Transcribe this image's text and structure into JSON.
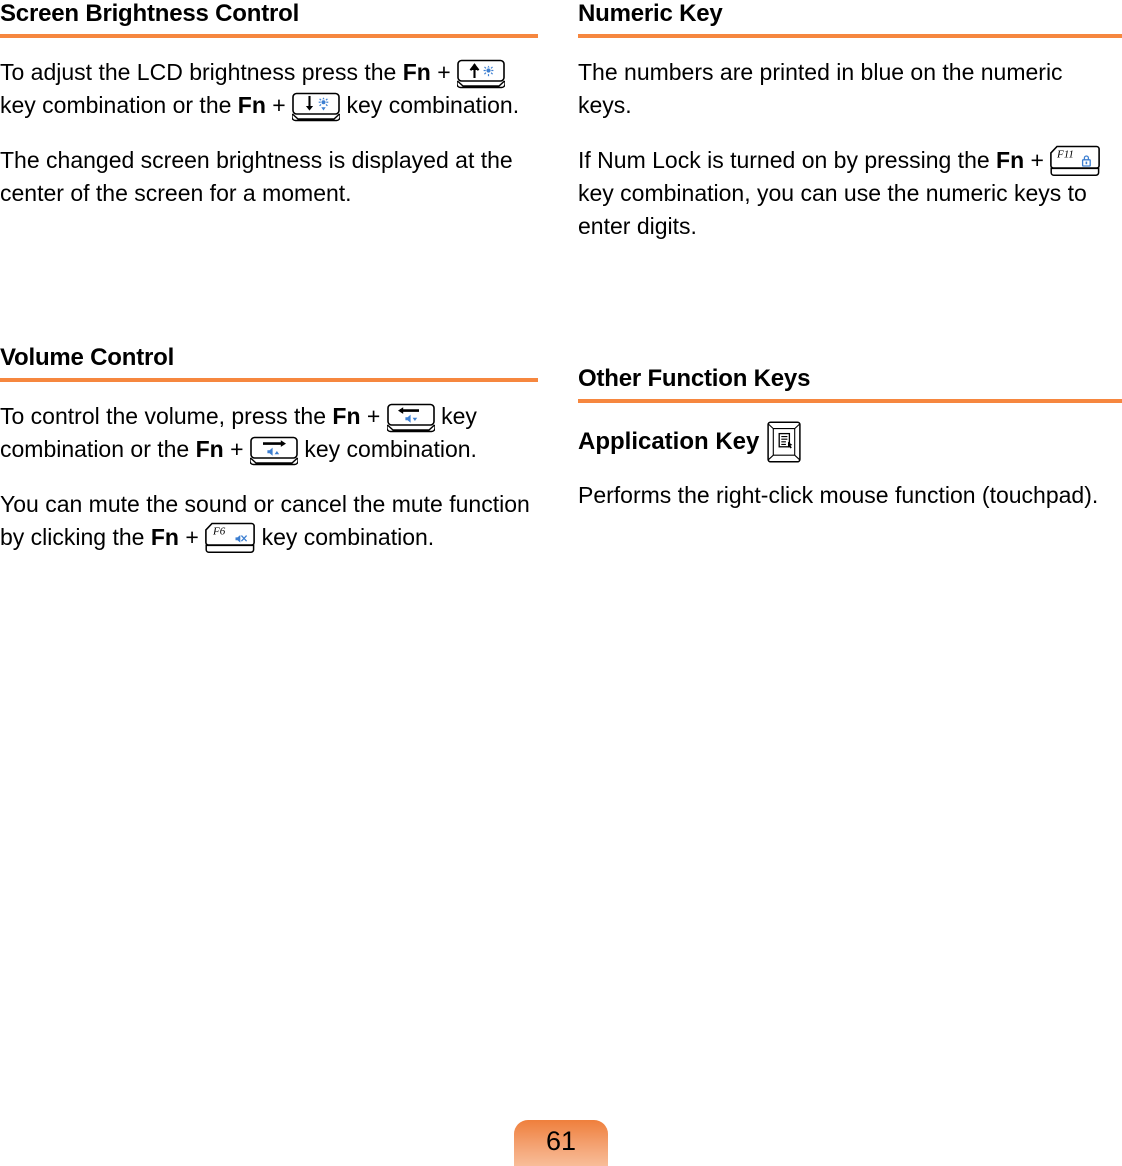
{
  "page": {
    "number": "61",
    "accent_color": "#f6873f",
    "key_icon_blue": "#3d7fd1",
    "text_color": "#000000",
    "background": "#ffffff"
  },
  "left_column": {
    "sections": [
      {
        "heading": "Screen Brightness Control",
        "paragraphs": [
          {
            "parts": [
              {
                "type": "text",
                "value": "To adjust the LCD brightness press the "
              },
              {
                "type": "bold",
                "value": "Fn"
              },
              {
                "type": "text",
                "value": " + "
              },
              {
                "type": "key",
                "value": "brightness-up-key"
              },
              {
                "type": "text",
                "value": " key combination or the "
              },
              {
                "type": "bold",
                "value": "Fn"
              },
              {
                "type": "text",
                "value": " + "
              },
              {
                "type": "key",
                "value": "brightness-down-key"
              },
              {
                "type": "text",
                "value": " key combination."
              }
            ]
          },
          {
            "parts": [
              {
                "type": "text",
                "value": "The changed screen brightness is displayed at the center of the screen for a moment."
              }
            ]
          }
        ]
      },
      {
        "heading": "Volume Control",
        "paragraphs": [
          {
            "parts": [
              {
                "type": "text",
                "value": "To control the volume, press the "
              },
              {
                "type": "bold",
                "value": "Fn"
              },
              {
                "type": "text",
                "value": " + "
              },
              {
                "type": "key",
                "value": "volume-down-key"
              },
              {
                "type": "text",
                "value": " key combination or the "
              },
              {
                "type": "bold",
                "value": "Fn"
              },
              {
                "type": "text",
                "value": " + "
              },
              {
                "type": "key",
                "value": "volume-up-key"
              },
              {
                "type": "text",
                "value": " key combination."
              }
            ]
          },
          {
            "parts": [
              {
                "type": "text",
                "value": "You can mute the sound or cancel the mute function by clicking the "
              },
              {
                "type": "bold",
                "value": "Fn"
              },
              {
                "type": "text",
                "value": " + "
              },
              {
                "type": "key",
                "value": "mute-key-f6"
              },
              {
                "type": "text",
                "value": " key combination."
              }
            ]
          }
        ]
      }
    ]
  },
  "right_column": {
    "sections": [
      {
        "heading": "Numeric Key",
        "paragraphs": [
          {
            "parts": [
              {
                "type": "text",
                "value": "The numbers are printed in blue on the numeric keys."
              }
            ]
          },
          {
            "parts": [
              {
                "type": "text",
                "value": "If Num Lock is turned on by pressing the "
              },
              {
                "type": "bold",
                "value": "Fn"
              },
              {
                "type": "text",
                "value": " + "
              },
              {
                "type": "key",
                "value": "num-lock-key-f11"
              },
              {
                "type": "text",
                "value": " key combination, you can use the numeric keys to enter digits."
              }
            ]
          }
        ]
      },
      {
        "heading": "Other Function Keys",
        "subheading": "Application Key",
        "subheading_key": "application-key",
        "paragraphs": [
          {
            "parts": [
              {
                "type": "text",
                "value": "Performs the right-click mouse function (touchpad)."
              }
            ]
          }
        ]
      }
    ]
  },
  "text": {
    "brightness_p1_a": "To adjust the LCD brightness press the ",
    "brightness_p1_fn1": "Fn",
    "brightness_p1_plus1": " + ",
    "brightness_p1_b": " key combination or the ",
    "brightness_p1_fn2": "Fn",
    "brightness_p1_plus2": " + ",
    "brightness_p1_c": " key combination.",
    "brightness_p2": "The changed screen brightness is displayed at the center of the screen for a moment.",
    "volume_p1_a": "To control the volume, press the ",
    "volume_p1_fn1": "Fn",
    "volume_p1_plus1": " + ",
    "volume_p1_b": " key combination or the ",
    "volume_p1_fn2": "Fn",
    "volume_p1_plus2": " + ",
    "volume_p1_c": " key combination.",
    "volume_p2_a": "You can mute the sound or cancel the mute function by clicking the ",
    "volume_p2_fn": "Fn",
    "volume_p2_plus": " + ",
    "volume_p2_b": " key combination.",
    "numeric_p1": "The numbers are printed in blue on the numeric keys.",
    "numeric_p2_a": "If Num Lock is turned on by pressing the ",
    "numeric_p2_fn": "Fn",
    "numeric_p2_plus": " + ",
    "numeric_p2_b": " key combination, you can use the numeric keys to enter digits.",
    "other_sub": "Application Key",
    "other_p1": "Performs the right-click mouse function (touchpad)."
  },
  "headings": {
    "screen_brightness": "Screen Brightness Control",
    "volume_control": "Volume Control",
    "numeric_key": "Numeric Key",
    "other_function_keys": "Other Function Keys"
  },
  "key_labels": {
    "f6": "F6",
    "f11": "F11"
  }
}
